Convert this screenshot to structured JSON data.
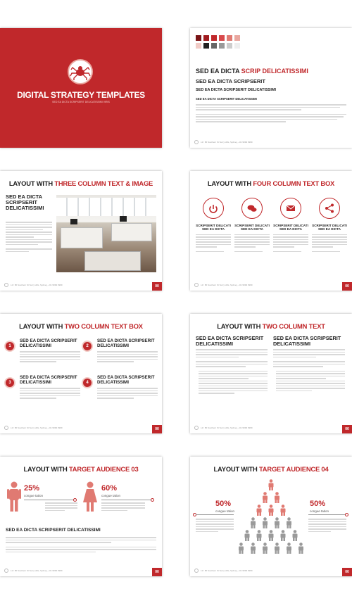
{
  "slide1": {
    "title": "DIGITAL STRATEGY TEMPLATES",
    "subtitle": "SED EA DICTA SCRIPSERIT DELICATISSIMI VIRIS",
    "bg_color": "#c0282b",
    "icon": "spider-icon"
  },
  "slide2": {
    "swatches": [
      "#7a1416",
      "#a01c1f",
      "#c0282b",
      "#d8494b",
      "#e07a72",
      "#e9a79f",
      "#f1cbc6",
      "#222222",
      "#666666",
      "#999999",
      "#cccccc",
      "#eeeeee"
    ],
    "h1_black": "SED EA DICTA ",
    "h1_red": "SCRIP DELICATISSIMI",
    "h2": "SED EA DICTA SCRIPSERIT",
    "h3": "SED EA DICTA SCRIPSERIT DELICATISSIMI",
    "h4": "SED EA DICTA SCRIPSERIT DELICATISSIMI",
    "footer": "L2 / 80 Southern St Surry Hills, Sydney, +61 9999 9999"
  },
  "slide3": {
    "title_black": "LAYOUT WITH ",
    "title_red": "THREE COLUMN TEXT & IMAGE",
    "heading": "SED EA DICTA SCRIPSERIT DELICATISSIMI",
    "footer": "L2 / 80 Southern St Surry Hills, Sydney, +61 9999 9999",
    "page": "00"
  },
  "slide4": {
    "title_black": "LAYOUT WITH ",
    "title_red": "FOUR COLUMN TEXT BOX",
    "icons": [
      "power-icon",
      "chat-icon",
      "mail-icon",
      "share-icon"
    ],
    "col_heading": "SCRIPSERIT DELICATI SED EA DICTA",
    "footer": "L2 / 80 Southern St Surry Hills, Sydney, +61 9999 9999",
    "page": "00"
  },
  "slide5": {
    "title_black": "LAYOUT WITH ",
    "title_red": "TWO COLUMN TEXT BOX",
    "items": [
      {
        "num": "1",
        "heading": "SED EA DICTA SCRIPSERIT DELICATISSIMI"
      },
      {
        "num": "2",
        "heading": "SED EA DICTA SCRIPSERIT DELICATISSIMI"
      },
      {
        "num": "3",
        "heading": "SED EA DICTA SCRIPSERIT DELICATISSIMI"
      },
      {
        "num": "4",
        "heading": "SED EA DICTA SCRIPSERIT DELICATISSIMI"
      }
    ],
    "footer": "L2 / 80 Southern St Surry Hills, Sydney, +61 9999 9999",
    "page": "00"
  },
  "slide6": {
    "title_black": "LAYOUT WITH ",
    "title_red": "TWO COLUMN TEXT",
    "col1_heading": "SED EA DICTA SCRIPSERIT DELICATISSIMI",
    "col2_heading": "SED EA DICTA SCRIPSERIT DELICATISSIMI",
    "footer": "L2 / 80 Southern St Surry Hills, Sydney, +61 9999 9999",
    "page": "00"
  },
  "slide7": {
    "title_black": "LAYOUT WITH ",
    "title_red": "TARGET AUDIENCE 03",
    "stat1_value": "25%",
    "stat1_label": "congue tation",
    "stat2_value": "60%",
    "stat2_label": "congue tation",
    "heading": "SED EA DICTA SCRIPSERIT DELICATISSIMI",
    "footer": "L2 / 80 Southern St Surry Hills, Sydney, +61 9999 9999",
    "page": "00"
  },
  "slide8": {
    "title_black": "LAYOUT WITH ",
    "title_red": "TARGET AUDIENCE 04",
    "stat1_value": "50%",
    "stat1_label": "congue tation",
    "stat2_value": "50%",
    "stat2_label": "congue tation",
    "footer": "L2 / 80 Southern St Surry Hills, Sydney, +61 9999 9999",
    "page": "00"
  }
}
